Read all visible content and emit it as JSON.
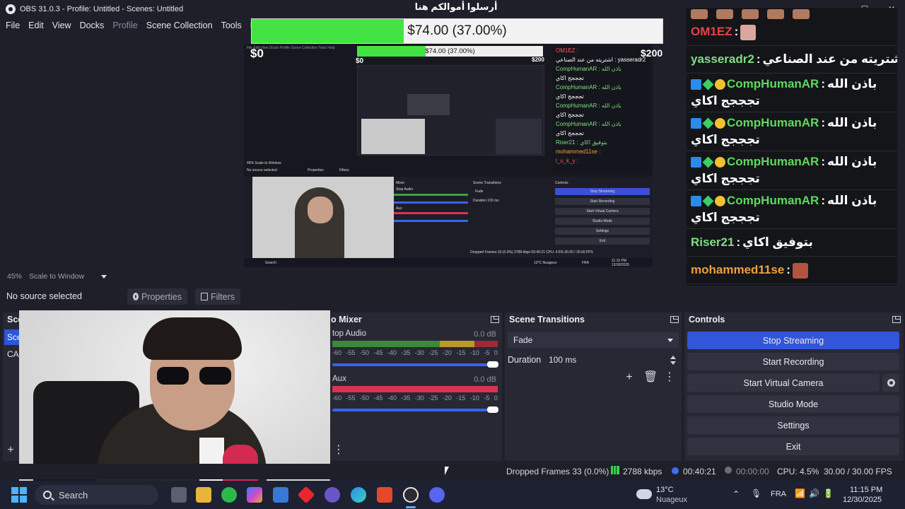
{
  "window": {
    "title": "OBS 31.0.3 - Profile: Untitled - Scenes: Untitled",
    "controls": [
      "—",
      "☐",
      "✕"
    ]
  },
  "menu": [
    "File",
    "Edit",
    "View",
    "Docks",
    "Profile",
    "Scene Collection",
    "Tools",
    "Help"
  ],
  "goal": {
    "title": "أرسلوا أموالكم هنا",
    "progress_text": "$74.00 (37.00%)",
    "progress": 0.37,
    "min": "$0",
    "max": "$200",
    "fill_color": "#44e344"
  },
  "mirror": {
    "menu": "File  Edit  View  Docks  Profile  Scene Collection  Tools  Help",
    "progress_text": "$74.00 (37.00%)",
    "min": "$0",
    "max": "$200",
    "chat": [
      "OM1EZ :",
      "اشتريته من عند الصناعي : yasseradr2",
      "CompHumanAR : باذن الله",
      "تجججج اكاي",
      "CompHumanAR : باذن الله",
      "تجججج اكاي",
      "CompHumanAR : باذن الله",
      "تجججج اكاي",
      "CompHumanAR : باذن الله",
      "تجججج اكاي",
      "Riser21 : بتوفيق اكاي",
      "mohammed11se :",
      "l_u_k_y :"
    ],
    "zoom": "45%  Scale to Window",
    "no_source": "No source selected",
    "properties": "Properties",
    "filters": "Filters",
    "mixer": "Mixer",
    "desktop_audio": "Stop Audio",
    "aux": "Aux",
    "transitions": "Scene Transitions",
    "fade": "Fade",
    "duration": "Duration  100 ms",
    "controls": "Controls",
    "buttons": [
      "Stop Streaming",
      "Start Recording",
      "Start Virtual Camera",
      "Studio Mode",
      "Settings",
      "Exit"
    ],
    "status": "Dropped Frames 33 (0.0%)   2788 kbps   00:40:21   CPU: 4.5%   30.00 / 30.00 FPS",
    "search": "Search",
    "weather": "13°C Nuageux",
    "lang": "FRA",
    "time": "11:15 PM",
    "date": "12/30/2025"
  },
  "chat": {
    "messages": [
      {
        "name": "OM1EZ",
        "color": "#e8414a",
        "msg": "",
        "emote": "#d9a79b",
        "badges": false
      },
      {
        "name": "yasseradr2",
        "color": "#7ee07e",
        "msg": "اشتريته من عند الصناعي",
        "emote": "",
        "badges": false
      },
      {
        "name": "CompHumanAR",
        "color": "#5dd95d",
        "msg": "باذن الله",
        "msg2": "تجججج اكاي",
        "emote": "",
        "badges": true
      },
      {
        "name": "CompHumanAR",
        "color": "#5dd95d",
        "msg": "باذن الله",
        "msg2": "تجججج اكاي",
        "emote": "",
        "badges": true
      },
      {
        "name": "CompHumanAR",
        "color": "#5dd95d",
        "msg": "باذن الله",
        "msg2": "تجججج اكاي",
        "emote": "",
        "badges": true
      },
      {
        "name": "CompHumanAR",
        "color": "#5dd95d",
        "msg": "باذن الله",
        "msg2": "تجججج اكاي",
        "emote": "",
        "badges": true
      },
      {
        "name": "Riser21",
        "color": "#7ee07e",
        "msg": "بتوفيق اكاي",
        "emote": "",
        "badges": false
      },
      {
        "name": "mohammed11se",
        "color": "#f0a03c",
        "msg": "",
        "emote": "#b4533e",
        "badges": false
      },
      {
        "name": "l_u_k_y",
        "color": "#e02a2a",
        "msg": "",
        "emote": "#9a6c55",
        "badges": false
      }
    ],
    "separator": ":"
  },
  "preview": {
    "zoom": "45%",
    "scale_mode": "Scale to Window"
  },
  "source_toolbar": {
    "no_source": "No source selected",
    "properties": "Properties",
    "filters": "Filters"
  },
  "scenes": {
    "title": "Sce",
    "items": [
      "Sce",
      "CAN"
    ],
    "add": "+"
  },
  "mixer": {
    "title": "o Mixer",
    "channels": [
      {
        "name": "top Audio",
        "db": "0.0 dB"
      },
      {
        "name": "Aux",
        "db": "0.0 dB"
      }
    ],
    "scale": [
      "-60",
      "-55",
      "-50",
      "-45",
      "-40",
      "-35",
      "-30",
      "-25",
      "-20",
      "-15",
      "-10",
      "-5",
      "0"
    ],
    "menu": "⋮"
  },
  "transitions": {
    "title": "Scene Transitions",
    "selected": "Fade",
    "duration_label": "Duration",
    "duration_value": "100 ms"
  },
  "controls": {
    "title": "Controls",
    "buttons": [
      "Stop Streaming",
      "Start Recording",
      "Start Virtual Camera",
      "Studio Mode",
      "Settings",
      "Exit"
    ]
  },
  "status": {
    "dropped": "Dropped Frames 33 (0.0%)",
    "kbps": "2788 kbps",
    "live_time": "00:40:21",
    "rec_time": "00:00:00",
    "cpu": "CPU: 4.5%",
    "fps": "30.00 / 30.00 FPS"
  },
  "taskbar": {
    "search": "Search",
    "temperature": "13°C",
    "weather": "Nuageux",
    "language": "FRA",
    "time": "11:15 PM",
    "date": "12/30/2025"
  }
}
